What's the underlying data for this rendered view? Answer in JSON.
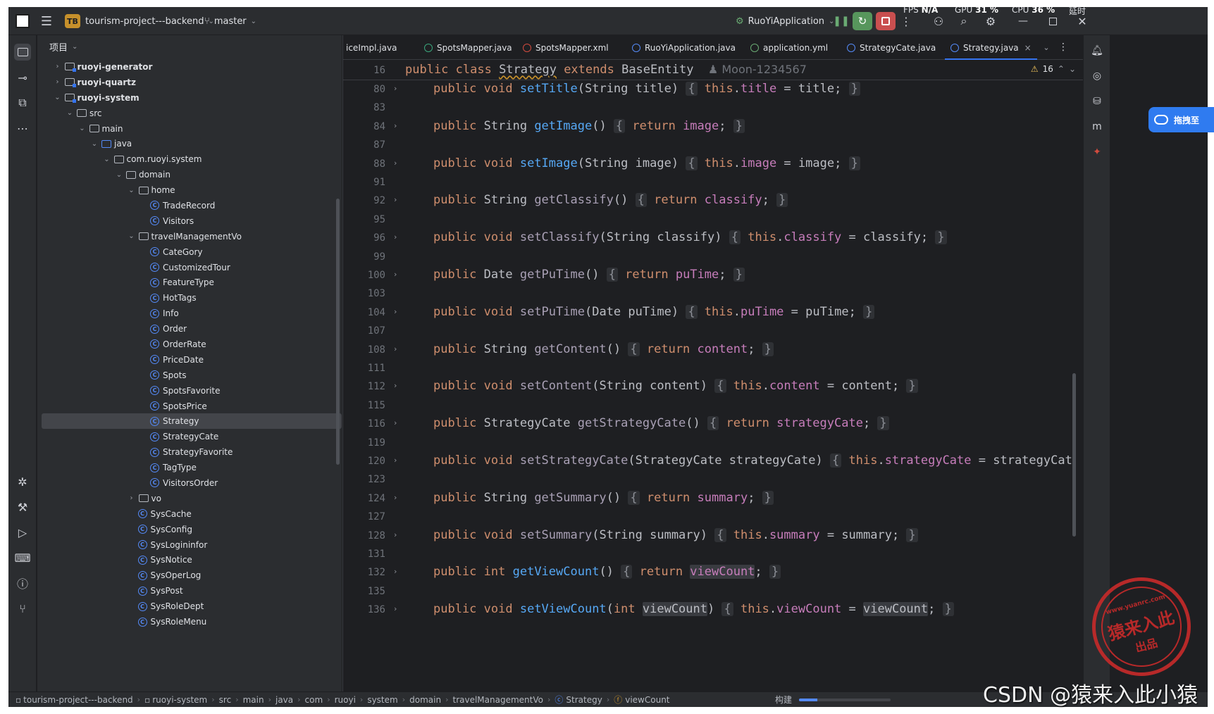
{
  "titlebar": {
    "project_badge": "TB",
    "project_name": "tourism-project---backend",
    "branch": "master",
    "run_config": "RuoYiApplication",
    "fps_label": "FPS",
    "fps_value": "N/A",
    "gpu_label": "GPU",
    "gpu_value": "31 %",
    "cpu_label": "CPU",
    "cpu_value": "36 %",
    "latency_label": "延时"
  },
  "project_panel": {
    "header": "项目",
    "rows": [
      {
        "label": "ruoyi-generator",
        "indent": 1,
        "chev": "›",
        "kind": "module",
        "bold": true
      },
      {
        "label": "ruoyi-quartz",
        "indent": 1,
        "chev": "›",
        "kind": "module",
        "bold": true
      },
      {
        "label": "ruoyi-system",
        "indent": 1,
        "chev": "⌄",
        "kind": "module",
        "bold": true
      },
      {
        "label": "src",
        "indent": 2,
        "chev": "⌄",
        "kind": "folder"
      },
      {
        "label": "main",
        "indent": 3,
        "chev": "⌄",
        "kind": "folder"
      },
      {
        "label": "java",
        "indent": 4,
        "chev": "⌄",
        "kind": "folder-blue"
      },
      {
        "label": "com.ruoyi.system",
        "indent": 5,
        "chev": "⌄",
        "kind": "package"
      },
      {
        "label": "domain",
        "indent": 6,
        "chev": "⌄",
        "kind": "package"
      },
      {
        "label": "home",
        "indent": 7,
        "chev": "⌄",
        "kind": "package"
      },
      {
        "label": "TradeRecord",
        "indent": 8,
        "chev": "",
        "kind": "class"
      },
      {
        "label": "Visitors",
        "indent": 8,
        "chev": "",
        "kind": "class"
      },
      {
        "label": "travelManagementVo",
        "indent": 7,
        "chev": "⌄",
        "kind": "package"
      },
      {
        "label": "CateGory",
        "indent": 8,
        "chev": "",
        "kind": "class"
      },
      {
        "label": "CustomizedTour",
        "indent": 8,
        "chev": "",
        "kind": "class"
      },
      {
        "label": "FeatureType",
        "indent": 8,
        "chev": "",
        "kind": "class"
      },
      {
        "label": "HotTags",
        "indent": 8,
        "chev": "",
        "kind": "class"
      },
      {
        "label": "Info",
        "indent": 8,
        "chev": "",
        "kind": "class"
      },
      {
        "label": "Order",
        "indent": 8,
        "chev": "",
        "kind": "class"
      },
      {
        "label": "OrderRate",
        "indent": 8,
        "chev": "",
        "kind": "class"
      },
      {
        "label": "PriceDate",
        "indent": 8,
        "chev": "",
        "kind": "class"
      },
      {
        "label": "Spots",
        "indent": 8,
        "chev": "",
        "kind": "class"
      },
      {
        "label": "SpotsFavorite",
        "indent": 8,
        "chev": "",
        "kind": "class"
      },
      {
        "label": "SpotsPrice",
        "indent": 8,
        "chev": "",
        "kind": "class"
      },
      {
        "label": "Strategy",
        "indent": 8,
        "chev": "",
        "kind": "class",
        "selected": true
      },
      {
        "label": "StrategyCate",
        "indent": 8,
        "chev": "",
        "kind": "class"
      },
      {
        "label": "StrategyFavorite",
        "indent": 8,
        "chev": "",
        "kind": "class"
      },
      {
        "label": "TagType",
        "indent": 8,
        "chev": "",
        "kind": "class"
      },
      {
        "label": "VisitorsOrder",
        "indent": 8,
        "chev": "",
        "kind": "class"
      },
      {
        "label": "vo",
        "indent": 7,
        "chev": "›",
        "kind": "package"
      },
      {
        "label": "SysCache",
        "indent": 7,
        "chev": "",
        "kind": "class"
      },
      {
        "label": "SysConfig",
        "indent": 7,
        "chev": "",
        "kind": "class"
      },
      {
        "label": "SysLogininfor",
        "indent": 7,
        "chev": "",
        "kind": "class"
      },
      {
        "label": "SysNotice",
        "indent": 7,
        "chev": "",
        "kind": "class"
      },
      {
        "label": "SysOperLog",
        "indent": 7,
        "chev": "",
        "kind": "class"
      },
      {
        "label": "SysPost",
        "indent": 7,
        "chev": "",
        "kind": "class"
      },
      {
        "label": "SysRoleDept",
        "indent": 7,
        "chev": "",
        "kind": "class"
      },
      {
        "label": "SysRoleMenu",
        "indent": 7,
        "chev": "",
        "kind": "class"
      }
    ]
  },
  "editor": {
    "tabs": [
      {
        "label": "iceImpl.java",
        "color": "#548af7"
      },
      {
        "label": "SpotsMapper.java",
        "color": "#3aa67c"
      },
      {
        "label": "SpotsMapper.xml",
        "color": "#d24b3e"
      },
      {
        "label": "RuoYiApplication.java",
        "color": "#548af7"
      },
      {
        "label": "application.yml",
        "color": "#6aab73"
      },
      {
        "label": "StrategyCate.java",
        "color": "#548af7"
      },
      {
        "label": "Strategy.java",
        "color": "#548af7",
        "active": true,
        "closable": "×"
      }
    ],
    "warning_count": "16",
    "sticky_line": {
      "num": "16",
      "author": "Moon-1234567"
    },
    "lines": [
      {
        "num": "80",
        "fold": true,
        "ret": "void",
        "name": "setTitle",
        "params": "String title",
        "body_kw": "this",
        "field": "title",
        "arg": "title"
      },
      {
        "num": "83"
      },
      {
        "num": "84",
        "fold": true,
        "ret": "String",
        "name": "getImage",
        "params": "",
        "field": "image"
      },
      {
        "num": "87"
      },
      {
        "num": "88",
        "fold": true,
        "ret": "void",
        "name": "setImage",
        "params": "String image",
        "body_kw": "this",
        "field": "image",
        "arg": "image"
      },
      {
        "num": "91"
      },
      {
        "num": "92",
        "fold": true,
        "ret": "String",
        "name": "getClassify",
        "params": "",
        "field": "classify",
        "dim": true
      },
      {
        "num": "95"
      },
      {
        "num": "96",
        "fold": true,
        "ret": "void",
        "name": "setClassify",
        "params": "String classify",
        "body_kw": "this",
        "field": "classify",
        "arg": "classify",
        "dim": true
      },
      {
        "num": "99"
      },
      {
        "num": "100",
        "fold": true,
        "ret": "Date",
        "name": "getPuTime",
        "params": "",
        "field": "puTime",
        "dim": true
      },
      {
        "num": "103"
      },
      {
        "num": "104",
        "fold": true,
        "ret": "void",
        "name": "setPuTime",
        "params": "Date puTime",
        "body_kw": "this",
        "field": "puTime",
        "arg": "puTime",
        "dim": true
      },
      {
        "num": "107"
      },
      {
        "num": "108",
        "fold": true,
        "ret": "String",
        "name": "getContent",
        "params": "",
        "field": "content",
        "dim": true
      },
      {
        "num": "111"
      },
      {
        "num": "112",
        "fold": true,
        "ret": "void",
        "name": "setContent",
        "params": "String content",
        "body_kw": "this",
        "field": "content",
        "arg": "content",
        "dim": true
      },
      {
        "num": "115"
      },
      {
        "num": "116",
        "fold": true,
        "ret": "StrategyCate",
        "name": "getStrategyCate",
        "params": "",
        "field": "strategyCate",
        "dim": true
      },
      {
        "num": "119"
      },
      {
        "num": "120",
        "fold": true,
        "ret": "void",
        "name": "setStrategyCate",
        "params": "StrategyCate strategyCate",
        "body_kw": "this",
        "field": "strategyCate",
        "arg": "strategyCate",
        "dim": true,
        "truncated": true
      },
      {
        "num": "123"
      },
      {
        "num": "124",
        "fold": true,
        "ret": "String",
        "name": "getSummary",
        "params": "",
        "field": "summary",
        "dim": true
      },
      {
        "num": "127"
      },
      {
        "num": "128",
        "fold": true,
        "ret": "void",
        "name": "setSummary",
        "params": "String summary",
        "body_kw": "this",
        "field": "summary",
        "arg": "summary",
        "dim": true
      },
      {
        "num": "131"
      },
      {
        "num": "132",
        "fold": true,
        "ret": "int",
        "name": "getViewCount",
        "params": "",
        "field": "viewCount",
        "hl": true
      },
      {
        "num": "135"
      },
      {
        "num": "136",
        "fold": true,
        "ret": "void",
        "name": "setViewCount",
        "params": "int viewCount",
        "body_kw": "this",
        "field": "viewCount",
        "arg": "viewCount",
        "hl": true
      }
    ]
  },
  "statusbar": {
    "crumbs": [
      "tourism-project---backend",
      "ruoyi-system",
      "src",
      "main",
      "java",
      "com",
      "ruoyi",
      "system",
      "domain",
      "travelManagementVo",
      "Strategy",
      "viewCount"
    ],
    "build_label": "构建"
  },
  "overlays": {
    "baidu_label": "拖拽至",
    "stamp_url": "www.yuanrc.com",
    "stamp_main": "猿来入此",
    "stamp_sub": "出品",
    "watermark": "CSDN @猿来入此小猿"
  },
  "colors": {
    "background": "#1e1f22",
    "panel": "#2b2d30",
    "accent": "#3574f0",
    "keyword": "#cf8e6d",
    "method": "#56a8f5",
    "field": "#c77dbb",
    "stamp": "#c02a2a"
  }
}
